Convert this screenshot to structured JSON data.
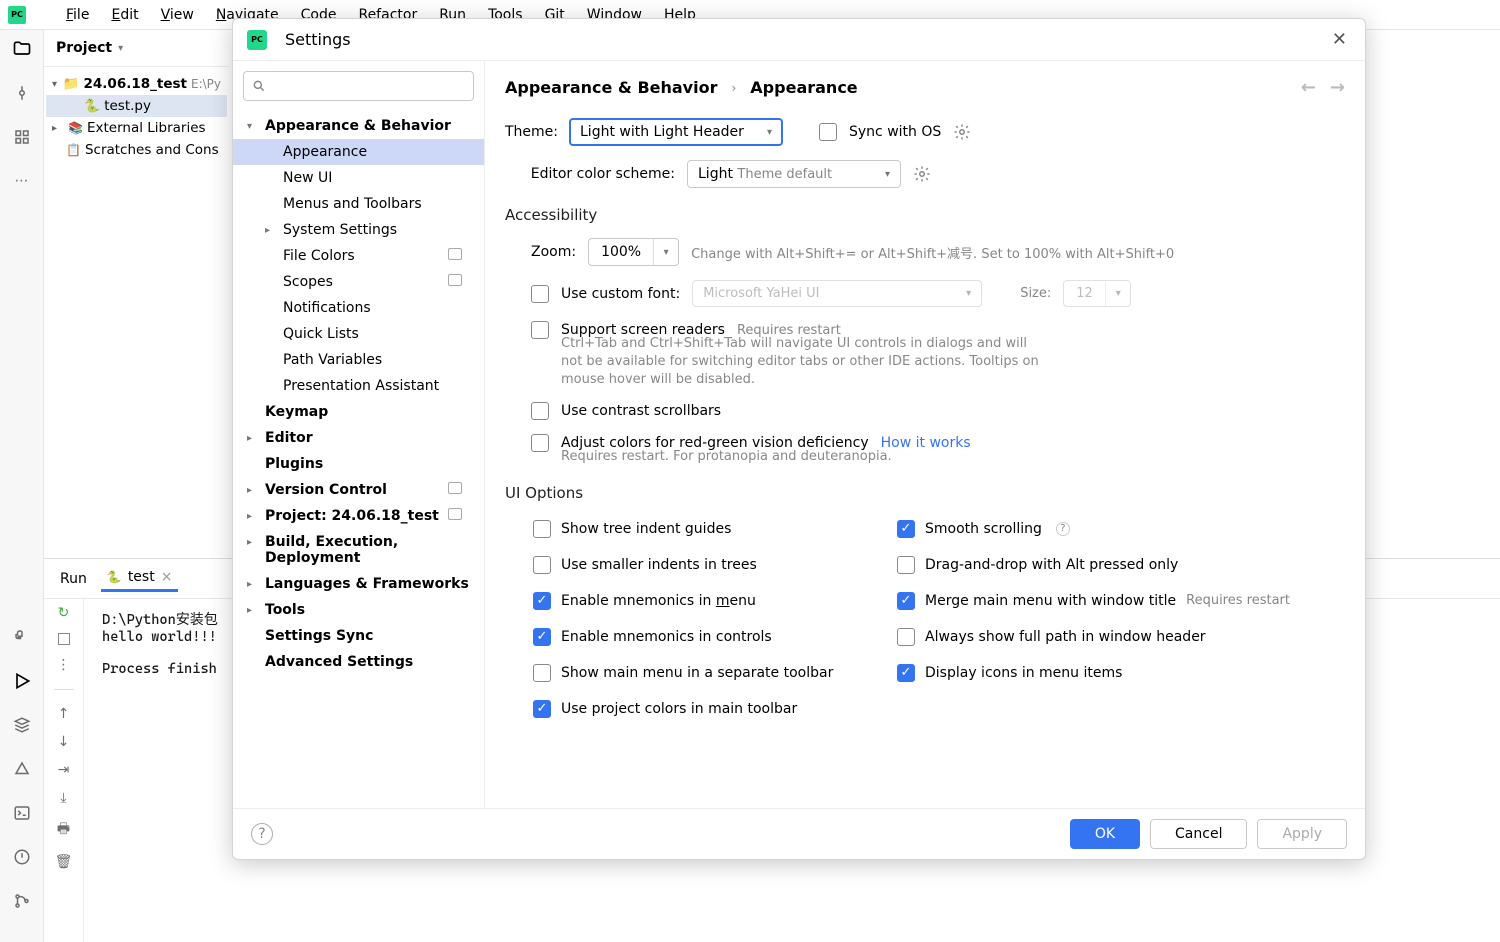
{
  "menubar": {
    "items": [
      "File",
      "Edit",
      "View",
      "Navigate",
      "Code",
      "Refactor",
      "Run",
      "Tools",
      "Git",
      "Window",
      "Help"
    ]
  },
  "project": {
    "title": "Project",
    "root": "24.06.18_test",
    "rootPath": "E:\\Py",
    "file": "test.py",
    "ext": "External Libraries",
    "scratch": "Scratches and Cons"
  },
  "run": {
    "tabRun": "Run",
    "tabName": "test",
    "output": "D:\\Python安装包\nhello world!!!\n\nProcess finish"
  },
  "dialog": {
    "title": "Settings",
    "search_placeholder": "",
    "breadcrumb1": "Appearance & Behavior",
    "breadcrumb2": "Appearance",
    "tree": {
      "appearance_behavior": "Appearance & Behavior",
      "appearance": "Appearance",
      "new_ui": "New UI",
      "menus_toolbars": "Menus and Toolbars",
      "system_settings": "System Settings",
      "file_colors": "File Colors",
      "scopes": "Scopes",
      "notifications": "Notifications",
      "quick_lists": "Quick Lists",
      "path_variables": "Path Variables",
      "presentation_assistant": "Presentation Assistant",
      "keymap": "Keymap",
      "editor": "Editor",
      "plugins": "Plugins",
      "version_control": "Version Control",
      "project": "Project: 24.06.18_test",
      "build": "Build, Execution, Deployment",
      "languages": "Languages & Frameworks",
      "tools": "Tools",
      "settings_sync": "Settings Sync",
      "advanced": "Advanced Settings"
    },
    "content": {
      "theme_label": "Theme:",
      "theme_value": "Light with Light Header",
      "sync_os": "Sync with OS",
      "editor_scheme_label": "Editor color scheme:",
      "editor_scheme_value": "Light",
      "editor_scheme_hint": "Theme default",
      "accessibility": "Accessibility",
      "zoom_label": "Zoom:",
      "zoom_value": "100%",
      "zoom_hint": "Change with Alt+Shift+= or Alt+Shift+减号. Set to 100% with Alt+Shift+0",
      "custom_font": "Use custom font:",
      "custom_font_value": "Microsoft YaHei UI",
      "size_label": "Size:",
      "size_value": "12",
      "screen_readers": "Support screen readers",
      "requires_restart": "Requires restart",
      "screen_readers_desc": "Ctrl+Tab and Ctrl+Shift+Tab will navigate UI controls in dialogs and will not be available for switching editor tabs or other IDE actions. Tooltips on mouse hover will be disabled.",
      "contrast_scrollbars": "Use contrast scrollbars",
      "color_deficiency": "Adjust colors for red-green vision deficiency",
      "how_it_works": "How it works",
      "color_def_sub": "Requires restart. For protanopia and deuteranopia.",
      "ui_options": "UI Options",
      "tree_indent": "Show tree indent guides",
      "smaller_indents": "Use smaller indents in trees",
      "mnemonics_menu": "Enable mnemonics in menu",
      "mnemonics_controls": "Enable mnemonics in controls",
      "main_menu_toolbar": "Show main menu in a separate toolbar",
      "project_colors": "Use project colors in main toolbar",
      "smooth_scrolling": "Smooth scrolling",
      "dnd_alt": "Drag-and-drop with Alt pressed only",
      "merge_menu": "Merge main menu with window title",
      "full_path": "Always show full path in window header",
      "display_icons": "Display icons in menu items"
    },
    "buttons": {
      "ok": "OK",
      "cancel": "Cancel",
      "apply": "Apply"
    }
  }
}
